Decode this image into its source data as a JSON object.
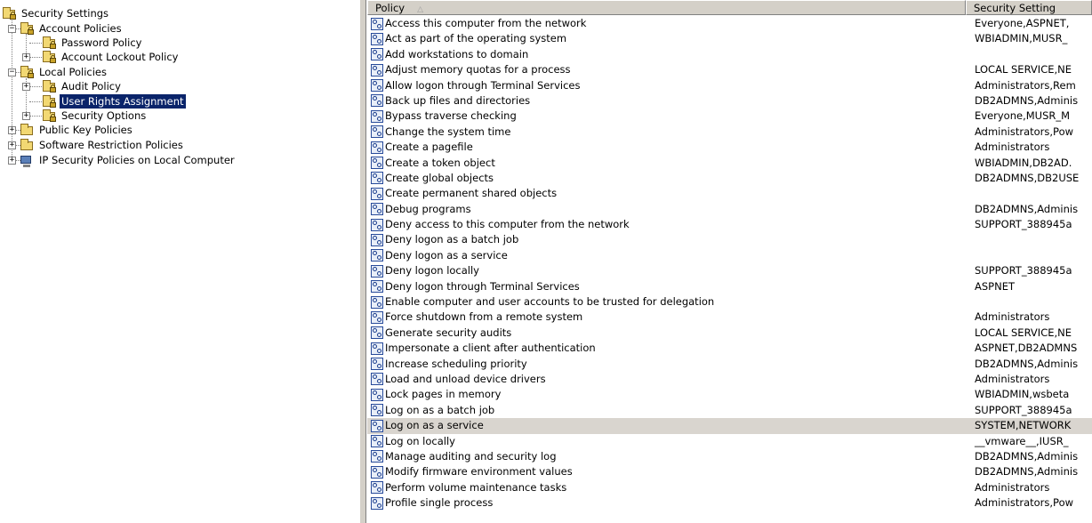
{
  "tree": {
    "root": {
      "label": "Security Settings",
      "icon": "security-settings-icon"
    },
    "account_policies": {
      "label": "Account Policies",
      "icon": "locked-folder-icon"
    },
    "password_policy": {
      "label": "Password Policy",
      "icon": "locked-folder-icon"
    },
    "account_lockout_policy": {
      "label": "Account Lockout Policy",
      "icon": "locked-folder-icon"
    },
    "local_policies": {
      "label": "Local Policies",
      "icon": "locked-folder-icon"
    },
    "audit_policy": {
      "label": "Audit Policy",
      "icon": "locked-folder-icon"
    },
    "user_rights_assignment": {
      "label": "User Rights Assignment",
      "icon": "locked-folder-icon",
      "selected": true
    },
    "security_options": {
      "label": "Security Options",
      "icon": "locked-folder-icon"
    },
    "public_key_policies": {
      "label": "Public Key Policies",
      "icon": "folder-icon"
    },
    "software_restriction_policies": {
      "label": "Software Restriction Policies",
      "icon": "folder-icon"
    },
    "ip_security_policies": {
      "label": "IP Security Policies on Local Computer",
      "icon": "computer-icon"
    },
    "expand_plus": "+",
    "expand_minus": "−"
  },
  "list": {
    "columns": {
      "policy": "Policy",
      "security_setting": "Security Setting"
    },
    "sort_indicator": "△",
    "rows": [
      {
        "policy": "Access this computer from the network",
        "setting": "Everyone,ASPNET,"
      },
      {
        "policy": "Act as part of the operating system",
        "setting": "WBIADMIN,MUSR_"
      },
      {
        "policy": "Add workstations to domain",
        "setting": ""
      },
      {
        "policy": "Adjust memory quotas for a process",
        "setting": "LOCAL SERVICE,NE"
      },
      {
        "policy": "Allow logon through Terminal Services",
        "setting": "Administrators,Rem"
      },
      {
        "policy": "Back up files and directories",
        "setting": "DB2ADMNS,Adminis"
      },
      {
        "policy": "Bypass traverse checking",
        "setting": "Everyone,MUSR_M"
      },
      {
        "policy": "Change the system time",
        "setting": "Administrators,Pow"
      },
      {
        "policy": "Create a pagefile",
        "setting": "Administrators"
      },
      {
        "policy": "Create a token object",
        "setting": "WBIADMIN,DB2AD."
      },
      {
        "policy": "Create global objects",
        "setting": "DB2ADMNS,DB2USE"
      },
      {
        "policy": "Create permanent shared objects",
        "setting": ""
      },
      {
        "policy": "Debug programs",
        "setting": "DB2ADMNS,Adminis"
      },
      {
        "policy": "Deny access to this computer from the network",
        "setting": "SUPPORT_388945a"
      },
      {
        "policy": "Deny logon as a batch job",
        "setting": ""
      },
      {
        "policy": "Deny logon as a service",
        "setting": ""
      },
      {
        "policy": "Deny logon locally",
        "setting": "SUPPORT_388945a"
      },
      {
        "policy": "Deny logon through Terminal Services",
        "setting": "ASPNET"
      },
      {
        "policy": "Enable computer and user accounts to be trusted for delegation",
        "setting": ""
      },
      {
        "policy": "Force shutdown from a remote system",
        "setting": "Administrators"
      },
      {
        "policy": "Generate security audits",
        "setting": "LOCAL SERVICE,NE"
      },
      {
        "policy": "Impersonate a client after authentication",
        "setting": "ASPNET,DB2ADMNS"
      },
      {
        "policy": "Increase scheduling priority",
        "setting": "DB2ADMNS,Adminis"
      },
      {
        "policy": "Load and unload device drivers",
        "setting": "Administrators"
      },
      {
        "policy": "Lock pages in memory",
        "setting": "WBIADMIN,wsbeta"
      },
      {
        "policy": "Log on as a batch job",
        "setting": "SUPPORT_388945a"
      },
      {
        "policy": "Log on as a service",
        "setting": "SYSTEM,NETWORK",
        "highlight": true
      },
      {
        "policy": "Log on locally",
        "setting": "__vmware__,IUSR_"
      },
      {
        "policy": "Manage auditing and security log",
        "setting": "DB2ADMNS,Adminis"
      },
      {
        "policy": "Modify firmware environment values",
        "setting": "DB2ADMNS,Adminis"
      },
      {
        "policy": "Perform volume maintenance tasks",
        "setting": "Administrators"
      },
      {
        "policy": "Profile single process",
        "setting": "Administrators,Pow"
      }
    ]
  }
}
